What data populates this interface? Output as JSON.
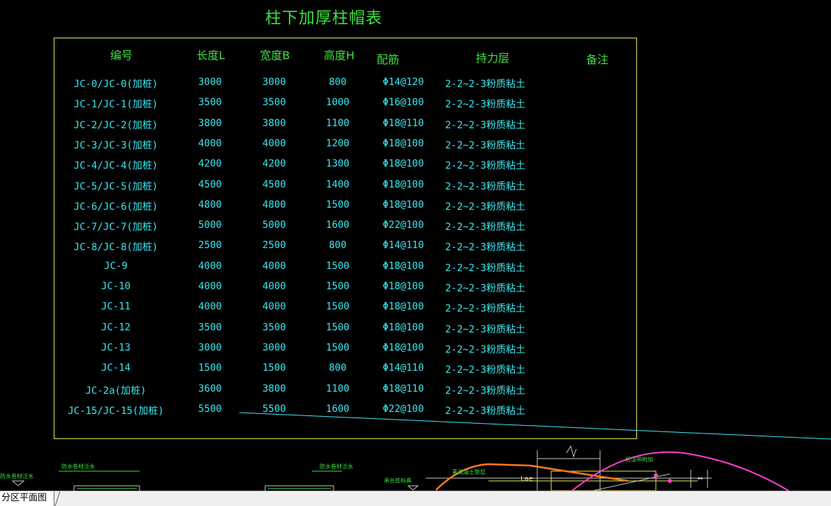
{
  "drawing": {
    "title": "柱下加厚柱帽表",
    "headers": [
      "编号",
      "长度L",
      "宽度B",
      "高度H",
      "配筋",
      "持力层",
      "备注"
    ],
    "rows": [
      {
        "id": "JC-0/JC-0(加桩)",
        "L": "3000",
        "B": "3000",
        "H": "800",
        "rebar": "Φ14@120",
        "layer": "2-2~2-3粉质粘土"
      },
      {
        "id": "JC-1/JC-1(加桩)",
        "L": "3500",
        "B": "3500",
        "H": "1000",
        "rebar": "Φ16@100",
        "layer": "2-2~2-3粉质粘土"
      },
      {
        "id": "JC-2/JC-2(加桩)",
        "L": "3800",
        "B": "3800",
        "H": "1100",
        "rebar": "Φ18@110",
        "layer": "2-2~2-3粉质粘土"
      },
      {
        "id": "JC-3/JC-3(加桩)",
        "L": "4000",
        "B": "4000",
        "H": "1200",
        "rebar": "Φ18@100",
        "layer": "2-2~2-3粉质粘土"
      },
      {
        "id": "JC-4/JC-4(加桩)",
        "L": "4200",
        "B": "4200",
        "H": "1300",
        "rebar": "Φ18@100",
        "layer": "2-2~2-3粉质粘土"
      },
      {
        "id": "JC-5/JC-5(加桩)",
        "L": "4500",
        "B": "4500",
        "H": "1400",
        "rebar": "Φ18@100",
        "layer": "2-2~2-3粉质粘土"
      },
      {
        "id": "JC-6/JC-6(加桩)",
        "L": "4800",
        "B": "4800",
        "H": "1500",
        "rebar": "Φ18@100",
        "layer": "2-2~2-3粉质粘土"
      },
      {
        "id": "JC-7/JC-7(加桩)",
        "L": "5000",
        "B": "5000",
        "H": "1600",
        "rebar": "Φ22@100",
        "layer": "2-2~2-3粉质粘土"
      },
      {
        "id": "JC-8/JC-8(加桩)",
        "L": "2500",
        "B": "2500",
        "H": "800",
        "rebar": "Φ14@110",
        "layer": "2-2~2-3粉质粘土"
      },
      {
        "id": "JC-9",
        "L": "4000",
        "B": "4000",
        "H": "1500",
        "rebar": "Φ18@100",
        "layer": "2-2~2-3粉质粘土"
      },
      {
        "id": "JC-10",
        "L": "4000",
        "B": "4000",
        "H": "1500",
        "rebar": "Φ18@100",
        "layer": "2-2~2-3粉质粘土"
      },
      {
        "id": "JC-11",
        "L": "4000",
        "B": "4000",
        "H": "1500",
        "rebar": "Φ18@100",
        "layer": "2-2~2-3粉质粘土"
      },
      {
        "id": "JC-12",
        "L": "3500",
        "B": "3500",
        "H": "1500",
        "rebar": "Φ18@100",
        "layer": "2-2~2-3粉质粘土"
      },
      {
        "id": "JC-13",
        "L": "3000",
        "B": "3000",
        "H": "1500",
        "rebar": "Φ18@100",
        "layer": "2-2~2-3粉质粘土"
      },
      {
        "id": "JC-14",
        "L": "1500",
        "B": "1500",
        "H": "800",
        "rebar": "Φ14@110",
        "layer": "2-2~2-3粉质粘土"
      },
      {
        "id": "JC-2a(加桩)",
        "L": "3600",
        "B": "3800",
        "H": "1100",
        "rebar": "Φ18@110",
        "layer": "2-2~2-3粉质粘土"
      },
      {
        "id": "JC-15/JC-15(加桩)",
        "L": "5500",
        "B": "5500",
        "H": "1600",
        "rebar": "Φ22@100",
        "layer": "2-2~2-3粉质粘土"
      }
    ],
    "lower_labels": [
      "防水卷材泛水",
      "防水卷材泛水",
      "承台底标高",
      "素混凝土垫层",
      "后浇带附加",
      "Lae"
    ]
  },
  "tabs": [
    {
      "label": "分区平面图"
    }
  ],
  "colors": {
    "background": "#000000",
    "header": "#3fe03f",
    "cell": "#39e8f0",
    "frame": "#e8e85a",
    "arc_magenta": "#ff3fcf",
    "arc_orange": "#ff7a1a",
    "line": "#3fe8ff"
  }
}
